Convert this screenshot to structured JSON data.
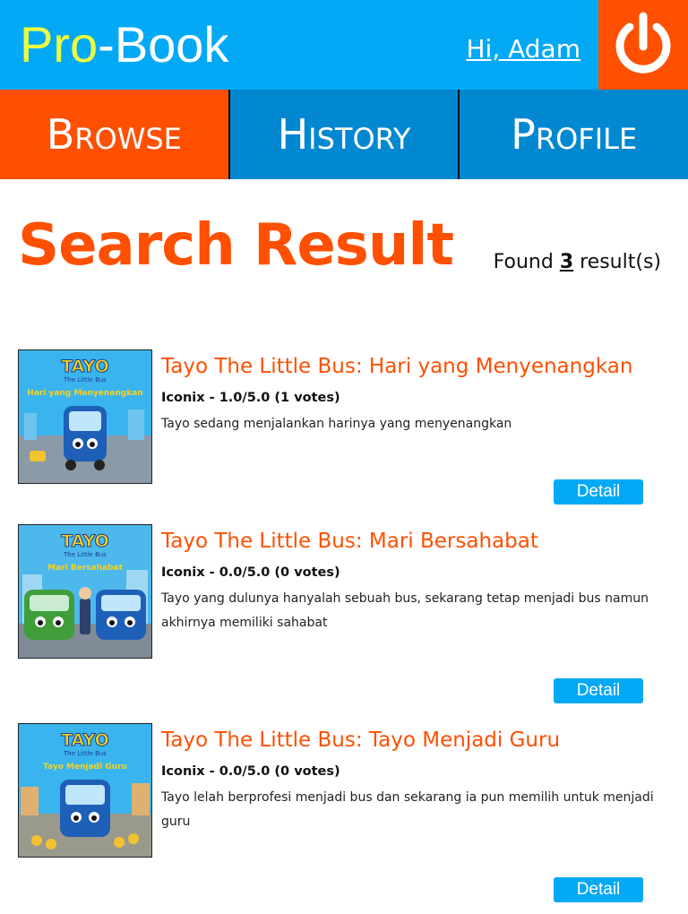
{
  "header": {
    "logo_pro": "Pro",
    "logo_dash": "-",
    "logo_book": "Book",
    "greeting": "Hi, Adam",
    "logout_icon": "power-icon"
  },
  "nav": {
    "tabs": [
      {
        "label": "Browse",
        "active": true
      },
      {
        "label": "History",
        "active": false
      },
      {
        "label": "Profile",
        "active": false
      }
    ]
  },
  "search": {
    "title": "Search Result",
    "found_prefix": "Found",
    "found_count": "3",
    "found_suffix": "result(s)"
  },
  "results": [
    {
      "title": "Tayo The Little Bus: Hari yang Menyenangkan",
      "meta": "Iconix - 1.0/5.0 (1 votes)",
      "description": "Tayo sedang menjalankan harinya yang menyenangkan",
      "cover_logo": "TAYO",
      "cover_subtitle": "The Little Bus",
      "cover_caption": "Hari yang Menyenangkan",
      "detail_label": "Detail"
    },
    {
      "title": "Tayo The Little Bus: Mari Bersahabat",
      "meta": "Iconix - 0.0/5.0 (0 votes)",
      "description": "Tayo yang dulunya hanyalah sebuah bus, sekarang tetap menjadi bus namun akhirnya memiliki sahabat",
      "cover_logo": "TAYO",
      "cover_subtitle": "The Little Bus",
      "cover_caption": "Mari Bersahabat",
      "detail_label": "Detail"
    },
    {
      "title": "Tayo The Little Bus: Tayo Menjadi Guru",
      "meta": "Iconix - 0.0/5.0 (0 votes)",
      "description": "Tayo lelah berprofesi menjadi bus dan sekarang ia pun memilih untuk menjadi guru",
      "cover_logo": "TAYO",
      "cover_subtitle": "The Little Bus",
      "cover_caption": "Tayo Menjadi Guru",
      "detail_label": "Detail"
    }
  ],
  "colors": {
    "header_blue": "#03a9f4",
    "nav_blue": "#0288d1",
    "accent_orange": "#ff4f00",
    "logo_yellow": "#eeff41"
  }
}
